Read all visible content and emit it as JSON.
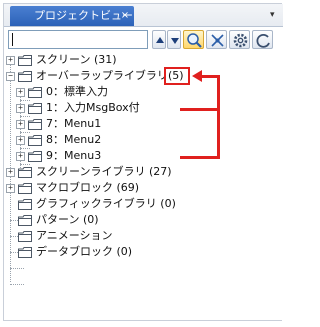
{
  "panel": {
    "tab_label": "プロジェクトビュー",
    "tab_close_glyph": "×",
    "tab_dropdown_glyph": "▾"
  },
  "toolbar": {
    "search_value": "",
    "buttons": [
      "up-icon",
      "down-icon",
      "search-icon",
      "collapse-icon",
      "gear-icon",
      "refresh-icon"
    ]
  },
  "tree": {
    "items": [
      {
        "label": "スクリーン (31)",
        "expanded": false,
        "icon": "folder-icon"
      },
      {
        "label": "オーバーラップライブラリ",
        "count": "(5)",
        "expanded": true,
        "icon": "folder-icon"
      },
      {
        "label": "0：標準入力",
        "expanded": false,
        "icon": "folder-icon"
      },
      {
        "label": "1：入力MsgBox付",
        "expanded": false,
        "icon": "folder-icon"
      },
      {
        "label": "7：Menu1",
        "expanded": false,
        "icon": "folder-icon"
      },
      {
        "label": "8：Menu2",
        "expanded": false,
        "icon": "folder-icon"
      },
      {
        "label": "9：Menu3",
        "expanded": false,
        "icon": "folder-icon"
      },
      {
        "label": "スクリーンライブラリ (27)",
        "expanded": false,
        "icon": "folder-icon"
      },
      {
        "label": "マクロブロック (69)",
        "expanded": false,
        "icon": "folder-icon"
      },
      {
        "label": "グラフィックライブラリ (0)",
        "icon": "folder-icon"
      },
      {
        "label": "パターン (0)",
        "icon": "folder-icon"
      },
      {
        "label": "アニメーション",
        "icon": "folder-icon"
      },
      {
        "label": "データブロック (0)",
        "icon": "folder-icon"
      }
    ]
  },
  "annotation": {
    "color": "#e0201e"
  }
}
